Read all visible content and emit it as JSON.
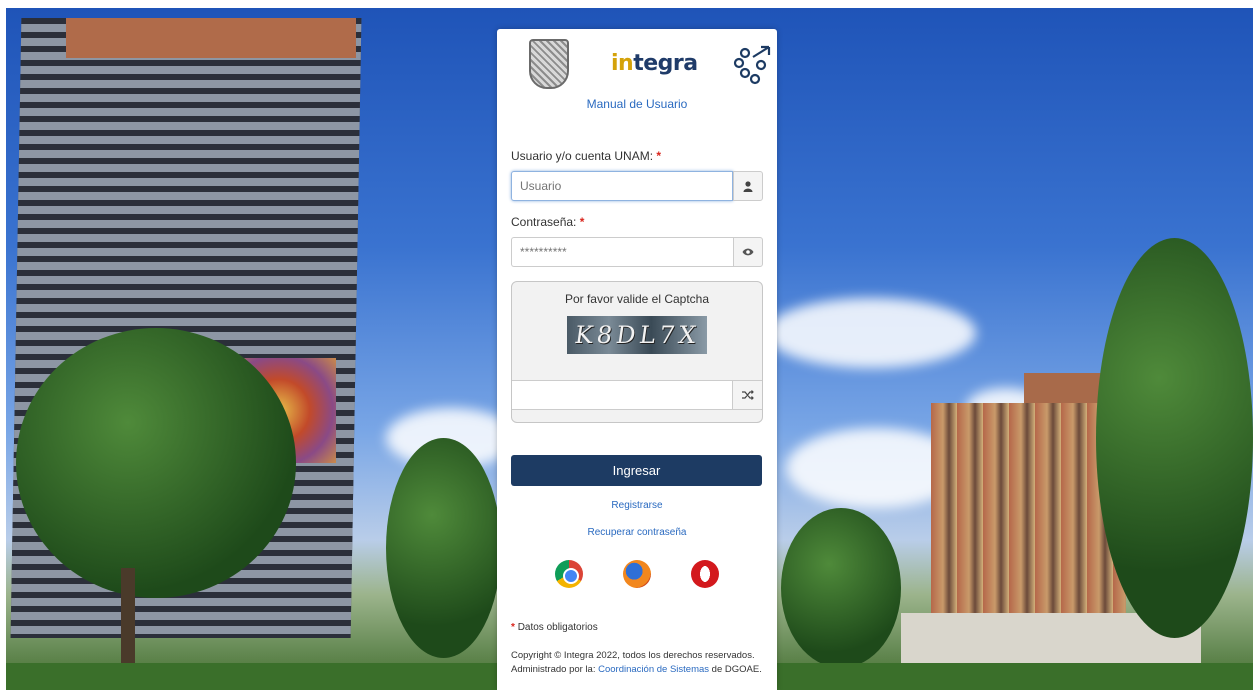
{
  "brand": {
    "name_accent": "in",
    "name_rest": "tegra"
  },
  "links": {
    "manual": "Manual de Usuario",
    "register": "Registrarse",
    "recover": "Recuperar contraseña"
  },
  "username": {
    "label": "Usuario y/o cuenta UNAM:",
    "required_mark": "*",
    "placeholder": "Usuario",
    "icon": "user-icon"
  },
  "password": {
    "label": "Contraseña:",
    "required_mark": "*",
    "placeholder": "**********",
    "icon": "eye-icon"
  },
  "captcha": {
    "title": "Por favor valide el Captcha",
    "image_text": "K8DL7X",
    "input_value": "",
    "refresh_icon": "shuffle-icon"
  },
  "submit": {
    "label": "Ingresar"
  },
  "browsers": [
    "chrome-icon",
    "firefox-icon",
    "opera-icon"
  ],
  "footer": {
    "required_mark": "*",
    "required_note": "Datos obligatorios",
    "copyright": "Copyright © Integra 2022, todos los derechos reservados.",
    "admin_prefix": "Administrado por la:",
    "admin_link": "Coordinación de Sistemas",
    "admin_suffix": "de DGOAE."
  },
  "colors": {
    "primary": "#1d3b63",
    "link": "#2a6ac0",
    "required": "#d9251c",
    "brand_accent": "#d4a20a"
  }
}
